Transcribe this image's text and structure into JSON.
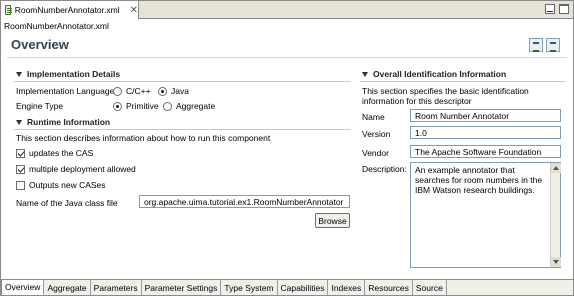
{
  "editor": {
    "tab_title": "RoomNumberAnnotator.xml",
    "subtitle": "RoomNumberAnnotator.xml",
    "page_title": "Overview"
  },
  "implementation": {
    "heading": "Implementation Details",
    "language_label": "Implementation Language",
    "language_options": [
      "C/C++",
      "Java"
    ],
    "language_selected": "Java",
    "engine_label": "Engine Type",
    "engine_options": [
      "Primitive",
      "Aggregate"
    ],
    "engine_selected": "Primitive"
  },
  "runtime": {
    "heading": "Runtime Information",
    "description": "This section describes information about how to run this component",
    "updates_cas_label": "updates the CAS",
    "updates_cas_checked": true,
    "multiple_deploy_label": "multiple deployment allowed",
    "multiple_deploy_checked": true,
    "outputs_cases_label": "Outputs new CASes",
    "outputs_cases_checked": false,
    "java_class_label": "Name of the Java class file",
    "java_class_value": "org.apache.uima.tutorial.ex1.RoomNumberAnnotator",
    "browse_label": "Browse"
  },
  "identification": {
    "heading": "Overall Identification Information",
    "description": "This section specifies the basic identification information for this descriptor",
    "name_label": "Name",
    "name_value": "Room Number Annotator",
    "version_label": "Version",
    "version_value": "1.0",
    "vendor_label": "Vendor",
    "vendor_value": "The Apache Software Foundation",
    "description_label": "Description:",
    "description_value": "An example annotator that searches for room numbers in the IBM Watson research buildings."
  },
  "bottom_tabs": [
    "Overview",
    "Aggregate",
    "Parameters",
    "Parameter Settings",
    "Type System",
    "Capabilities",
    "Indexes",
    "Resources",
    "Source"
  ],
  "active_tab": "Overview",
  "colors": {
    "title": "#31435a",
    "field_border": "#7f9db9",
    "tab_strip": "#e6e3d6"
  },
  "icons": [
    "xml-file-icon",
    "close-icon",
    "minimize-icon",
    "maximize-icon",
    "form-view-icon",
    "list-view-icon",
    "collapse-triangle-icon"
  ]
}
